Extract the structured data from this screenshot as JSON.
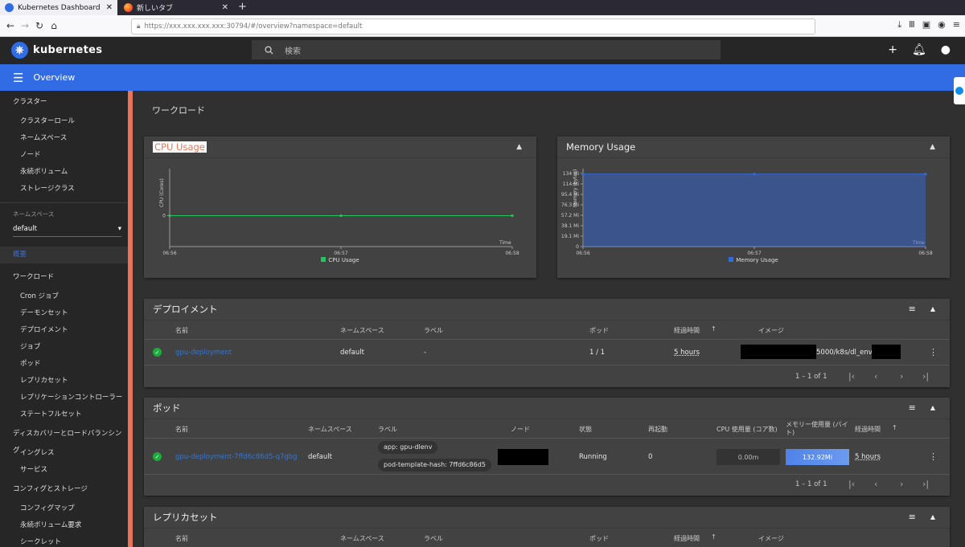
{
  "browser": {
    "tabs": [
      {
        "title": "Kubernetes Dashboard",
        "close": "✕"
      },
      {
        "title": "新しいタブ",
        "close": "✕"
      }
    ],
    "new_tab": "+",
    "url": "https://xxx.xxx.xxx.xxx:30794/#/overview?namespace=default"
  },
  "app": {
    "brand": "kubernetes",
    "search_placeholder": "検索",
    "page": "Overview"
  },
  "sidebar": {
    "cluster": {
      "title": "クラスター",
      "items": [
        "クラスターロール",
        "ネームスペース",
        "ノード",
        "永続ボリューム",
        "ストレージクラス"
      ]
    },
    "namespace": {
      "label": "ネームスペース",
      "value": "default"
    },
    "overview": "概要",
    "workloads": {
      "title": "ワークロード",
      "items": [
        "Cron ジョブ",
        "デーモンセット",
        "デプロイメント",
        "ジョブ",
        "ポッド",
        "レプリカセット",
        "レプリケーションコントローラー",
        "ステートフルセット"
      ]
    },
    "discovery": {
      "title": "ディスカバリーとロードバランシング",
      "items": [
        "イングレス",
        "サービス"
      ]
    },
    "config": {
      "title": "コンフィグとストレージ",
      "items": [
        "コンフィグマップ",
        "永続ボリューム要求",
        "シークレット"
      ]
    }
  },
  "main": {
    "workloads_heading": "ワークロード"
  },
  "cpu_card": {
    "title": "CPU Usage",
    "ytitle": "CPU (Cores)",
    "xlabel": "Time",
    "legend": "CPU Usage",
    "color": "#22c55e"
  },
  "mem_card": {
    "title": "Memory Usage",
    "ytitle": "Memory (bytes)",
    "xlabel": "Time",
    "legend": "Memory Usage",
    "color": "#326ce5"
  },
  "chart_data": [
    {
      "type": "line",
      "title": "CPU Usage",
      "xlabel": "Time",
      "ylabel": "CPU (Cores)",
      "x": [
        "06:56",
        "06:57",
        "06:58"
      ],
      "yticks": [
        "0"
      ],
      "series": [
        {
          "name": "CPU Usage",
          "values": [
            0,
            0,
            0
          ]
        }
      ]
    },
    {
      "type": "area",
      "title": "Memory Usage",
      "xlabel": "Time",
      "ylabel": "Memory (bytes)",
      "x": [
        "06:56",
        "06:57",
        "06:58"
      ],
      "yticks": [
        "0",
        "19.1 Mi",
        "38.1 Mi",
        "57.2 Mi",
        "76.3 Mi",
        "95.4 Mi",
        "114 Mi",
        "134 Mi"
      ],
      "ylim": [
        0,
        134
      ],
      "series": [
        {
          "name": "Memory Usage",
          "values": [
            132.92,
            132.92,
            132.92
          ]
        }
      ]
    }
  ],
  "deployments": {
    "title": "デプロイメント",
    "cols": [
      "名前",
      "ネームスペース",
      "ラベル",
      "ポッド",
      "経過時間",
      "イメージ"
    ],
    "rows": [
      {
        "name": "gpu-deployment",
        "namespace": "default",
        "labels": "-",
        "pods": "1 / 1",
        "age": "5 hours",
        "image": "5000/k8s/dl_env"
      }
    ],
    "pagination": "1 – 1 of 1"
  },
  "pods": {
    "title": "ポッド",
    "cols": [
      "名前",
      "ネームスペース",
      "ラベル",
      "ノード",
      "状態",
      "再起動",
      "CPU 使用量 (コア数)",
      "メモリー使用量 (バイト)",
      "経過時間"
    ],
    "rows": [
      {
        "name": "gpu-deployment-7ffd6c86d5-q7gbg",
        "namespace": "default",
        "labels": [
          "app: gpu-dlenv",
          "pod-template-hash: 7ffd6c86d5"
        ],
        "status": "Running",
        "restarts": "0",
        "cpu": "0.00m",
        "memory": "132.92Mi",
        "age": "5 hours"
      }
    ],
    "pagination": "1 – 1 of 1"
  },
  "replicasets": {
    "title": "レプリカセット",
    "cols": [
      "名前",
      "ネームスペース",
      "ラベル",
      "ポッド",
      "経過時間",
      "イメージ"
    ]
  }
}
